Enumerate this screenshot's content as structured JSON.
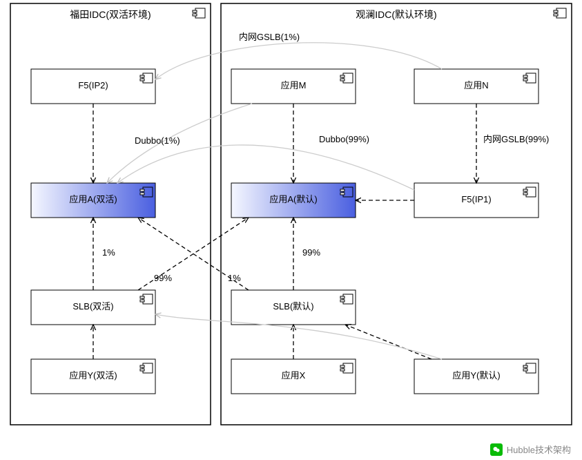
{
  "containers": {
    "left": {
      "title": "福田IDC(双活环境)"
    },
    "right": {
      "title": "观澜IDC(默认环境)"
    }
  },
  "nodes": {
    "f5ip2": {
      "label": "F5(IP2)"
    },
    "appM": {
      "label": "应用M"
    },
    "appN": {
      "label": "应用N"
    },
    "appA_act": {
      "label": "应用A(双活)"
    },
    "appA_def": {
      "label": "应用A(默认)"
    },
    "f5ip1": {
      "label": "F5(IP1)"
    },
    "slb_act": {
      "label": "SLB(双活)"
    },
    "slb_def": {
      "label": "SLB(默认)"
    },
    "appY_act": {
      "label": "应用Y(双活)"
    },
    "appX": {
      "label": "应用X"
    },
    "appY_def": {
      "label": "应用Y(默认)"
    }
  },
  "edges": {
    "gslb1": {
      "label": "内网GSLB(1%)"
    },
    "gslb99": {
      "label": "内网GSLB(99%)"
    },
    "dubbo1": {
      "label": "Dubbo(1%)"
    },
    "dubbo99": {
      "label": "Dubbo(99%)"
    },
    "p1a": {
      "label": "1%"
    },
    "p1b": {
      "label": "1%"
    },
    "p99a": {
      "label": "99%"
    },
    "p99b": {
      "label": "99%"
    }
  },
  "watermark": {
    "text": "Hubble技术架构"
  }
}
